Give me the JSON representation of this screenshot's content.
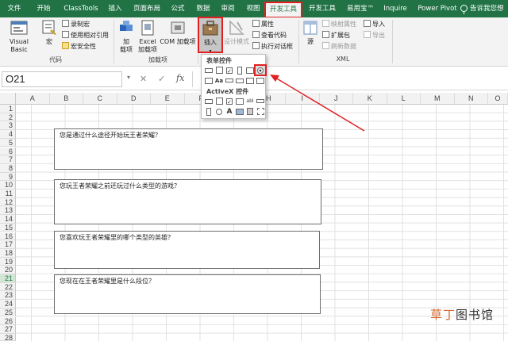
{
  "ribbon_tabs": [
    {
      "label": "文件",
      "active": false
    },
    {
      "label": "开始",
      "active": false
    },
    {
      "label": "ClassTools",
      "active": false
    },
    {
      "label": "插入",
      "active": false
    },
    {
      "label": "页面布局",
      "active": false
    },
    {
      "label": "公式",
      "active": false
    },
    {
      "label": "数据",
      "active": false
    },
    {
      "label": "审阅",
      "active": false
    },
    {
      "label": "视图",
      "active": false
    },
    {
      "label": "开发工具",
      "active": true
    },
    {
      "label": "开发工具",
      "active": false
    },
    {
      "label": "易用宝™",
      "active": false
    },
    {
      "label": "Inquire",
      "active": false
    },
    {
      "label": "Power Pivot",
      "active": false
    }
  ],
  "tell_me": "告诉我您想",
  "code_group": {
    "label": "代码",
    "visual_basic": "Visual Basic",
    "macros": "宏",
    "record_macro": "录制宏",
    "relative_refs": "使用相对引用",
    "macro_security": "宏安全性"
  },
  "addins_group": {
    "label": "加载项",
    "addins": [
      "加",
      "载项"
    ],
    "excel_addins": [
      "Excel",
      "加载项"
    ],
    "com_addins": "COM 加载项"
  },
  "controls_group": {
    "insert": "插入",
    "design_mode": "设计模式",
    "properties": "属性",
    "view_code": "查看代码",
    "run_dialog": "执行对话框"
  },
  "xml_group": {
    "label": "XML",
    "source": "源",
    "map_properties": "映射属性",
    "expansion_packs": "扩展包",
    "refresh_data": "刷新数据",
    "import": "导入",
    "export": "导出"
  },
  "formula_bar": {
    "name_box": "O21",
    "cancel": "✕",
    "enter": "✓",
    "fx": "fx",
    "value": ""
  },
  "dropdown": {
    "form_controls_title": "表单控件",
    "activex_title": "ActiveX 控件"
  },
  "columns": [
    "A",
    "B",
    "C",
    "D",
    "E",
    "F",
    "G",
    "H",
    "I",
    "J",
    "K",
    "L",
    "M",
    "N",
    "O"
  ],
  "rows": [
    "1",
    "2",
    "3",
    "4",
    "5",
    "6",
    "7",
    "8",
    "9",
    "10",
    "11",
    "12",
    "13",
    "14",
    "15",
    "16",
    "17",
    "18",
    "19",
    "20",
    "21",
    "22",
    "23",
    "24",
    "25",
    "26",
    "27",
    "28"
  ],
  "selected_row": "21",
  "questions": [
    "您是通过什么途径开始玩王者荣耀？",
    "您玩王者荣耀之前还玩过什么类型的游戏？",
    "您喜欢玩王者荣耀里的哪个类型的英雄？",
    "您现在在王者荣耀里是什么段位？"
  ],
  "watermark": {
    "lead": "草丁",
    "rest": "图书馆"
  },
  "colors": {
    "excel_green": "#217346",
    "highlight_red": "#e02020"
  }
}
